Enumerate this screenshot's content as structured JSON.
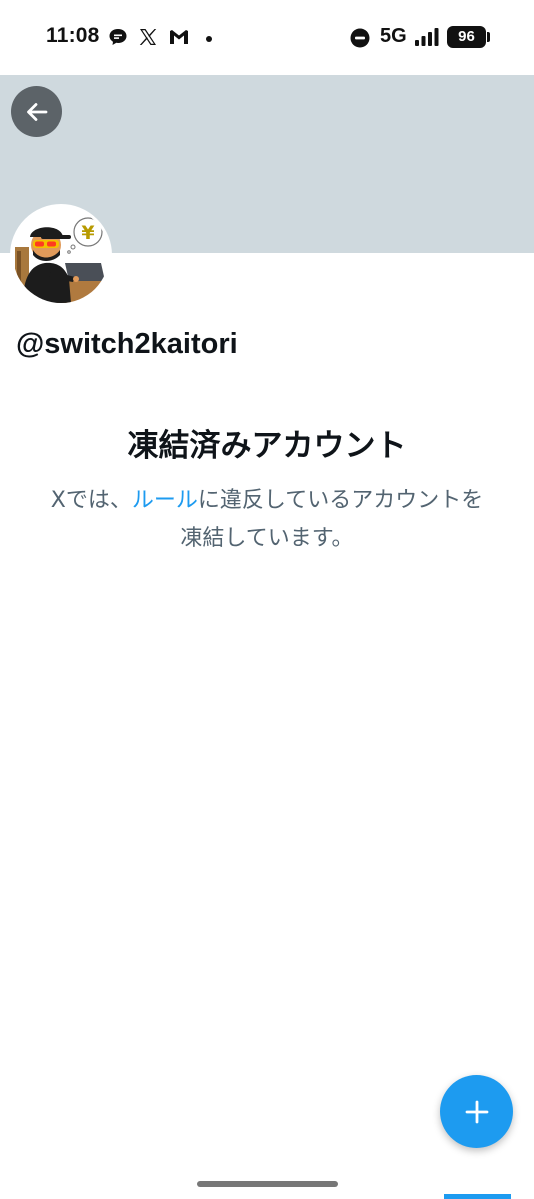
{
  "status_bar": {
    "time": "11:08",
    "network": "5G",
    "battery": "96",
    "icons": [
      "chat-bubble-icon",
      "x-logo-icon",
      "gmail-icon",
      "notification-dot",
      "do-not-disturb-icon",
      "signal-icon",
      "battery-icon"
    ]
  },
  "header": {
    "back_icon": "arrow-left-icon",
    "banner_color": "#cfd9de"
  },
  "profile": {
    "username": "@switch2kaitori",
    "avatar_sign": "¥"
  },
  "suspension": {
    "title": "凍結済みアカウント",
    "message_before": "Xでは、",
    "rules_link": "ルール",
    "message_after": "に違反しているアカウントを凍結しています。"
  },
  "fab": {
    "icon": "plus-icon"
  },
  "colors": {
    "accent": "#1d9bf0",
    "text_primary": "#0f1419",
    "text_secondary": "#536471"
  }
}
